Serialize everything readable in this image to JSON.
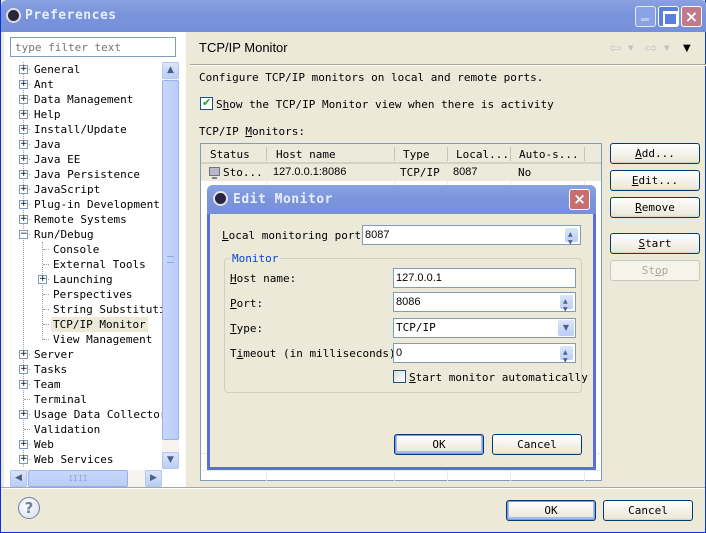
{
  "window": {
    "title": "Preferences",
    "controls": [
      "minimize-icon",
      "maximize-icon",
      "close-icon"
    ]
  },
  "sidebar": {
    "filter_placeholder": "type filter text",
    "tree": [
      {
        "label": "General",
        "level": 0,
        "expander": "+"
      },
      {
        "label": "Ant",
        "level": 0,
        "expander": "+"
      },
      {
        "label": "Data Management",
        "level": 0,
        "expander": "+"
      },
      {
        "label": "Help",
        "level": 0,
        "expander": "+"
      },
      {
        "label": "Install/Update",
        "level": 0,
        "expander": "+"
      },
      {
        "label": "Java",
        "level": 0,
        "expander": "+"
      },
      {
        "label": "Java EE",
        "level": 0,
        "expander": "+"
      },
      {
        "label": "Java Persistence",
        "level": 0,
        "expander": "+"
      },
      {
        "label": "JavaScript",
        "level": 0,
        "expander": "+"
      },
      {
        "label": "Plug-in Development",
        "level": 0,
        "expander": "+"
      },
      {
        "label": "Remote Systems",
        "level": 0,
        "expander": "+"
      },
      {
        "label": "Run/Debug",
        "level": 0,
        "expander": "-"
      },
      {
        "label": "Console",
        "level": 1,
        "expander": ""
      },
      {
        "label": "External Tools",
        "level": 1,
        "expander": ""
      },
      {
        "label": "Launching",
        "level": 1,
        "expander": "+"
      },
      {
        "label": "Perspectives",
        "level": 1,
        "expander": ""
      },
      {
        "label": "String Substitutic",
        "level": 1,
        "expander": ""
      },
      {
        "label": "TCP/IP Monitor",
        "level": 1,
        "expander": "",
        "selected": true
      },
      {
        "label": "View Management",
        "level": 1,
        "expander": ""
      },
      {
        "label": "Server",
        "level": 0,
        "expander": "+"
      },
      {
        "label": "Tasks",
        "level": 0,
        "expander": "+"
      },
      {
        "label": "Team",
        "level": 0,
        "expander": "+"
      },
      {
        "label": "Terminal",
        "level": 0,
        "expander": ""
      },
      {
        "label": "Usage Data Collector",
        "level": 0,
        "expander": "+"
      },
      {
        "label": "Validation",
        "level": 0,
        "expander": ""
      },
      {
        "label": "Web",
        "level": 0,
        "expander": "+"
      },
      {
        "label": "Web Services",
        "level": 0,
        "expander": "+"
      }
    ]
  },
  "page": {
    "title": "TCP/IP Monitor",
    "description": "Configure TCP/IP monitors on local and remote ports.",
    "show_view_checkbox": {
      "label_pre": "S",
      "label_mnemonic": "h",
      "label_post": "ow the TCP/IP Monitor view when there is activity",
      "checked": true
    },
    "monitors_label": {
      "pre": "TCP/IP ",
      "mnemonic": "M",
      "post": "onitors:"
    },
    "table": {
      "columns": [
        "Status",
        "Host name",
        "Type",
        "Local...",
        "Auto-s..."
      ],
      "rows": [
        {
          "status": "Sto...",
          "host": "127.0.0.1:8086",
          "type": "TCP/IP",
          "local": "8087",
          "auto": "No"
        }
      ]
    },
    "buttons": [
      {
        "mnemonic": "A",
        "rest": "dd...",
        "enabled": true
      },
      {
        "mnemonic": "E",
        "rest": "dit...",
        "enabled": true
      },
      {
        "mnemonic": "R",
        "rest": "emove",
        "enabled": true
      },
      {
        "mnemonic": "S",
        "rest": "tart",
        "enabled": true
      },
      {
        "pre": "St",
        "mnemonic": "o",
        "rest": "p",
        "enabled": false
      }
    ]
  },
  "footer": {
    "ok_label": "OK",
    "cancel_label": "Cancel"
  },
  "dialog": {
    "title": "Edit Monitor",
    "local_port": {
      "mnemonic": "L",
      "label": "ocal monitoring port:",
      "value": "8087"
    },
    "group_title": "Monitor",
    "host": {
      "mnemonic": "H",
      "label": "ost name:",
      "value": "127.0.0.1"
    },
    "port": {
      "mnemonic": "P",
      "label": "ort:",
      "value": "8086"
    },
    "type": {
      "mnemonic": "T",
      "label": "ype:",
      "value": "TCP/IP"
    },
    "timeout": {
      "pre": "T",
      "mnemonic": "i",
      "label": "meout (in milliseconds):",
      "value": "0"
    },
    "auto_start": {
      "mnemonic": "S",
      "label": "tart monitor automatically",
      "checked": false
    },
    "ok_label": "OK",
    "cancel_label": "Cancel"
  }
}
